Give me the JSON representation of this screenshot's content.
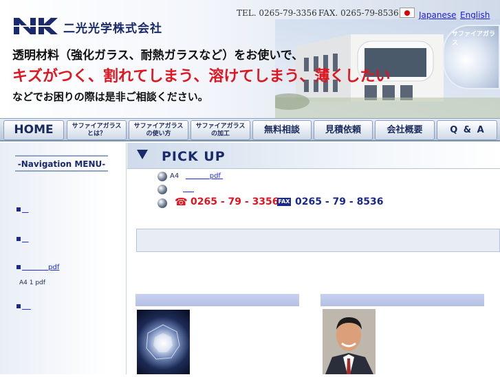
{
  "header": {
    "company_name": "二光光学株式会社",
    "tel": "TEL. 0265-79-3356",
    "fax": "FAX. 0265-79-8536",
    "lang_ja": "Japanese",
    "lang_en": "English",
    "sapphire_label": "サファイアガラス",
    "headline_1": "透明材料（強化ガラス、耐熱ガラスなど）をお使いで、",
    "headline_2": "キズがつく、割れてしまう、溶けてしまう、薄くしたい",
    "headline_3": "などでお困りの際は是非ご相談ください。"
  },
  "nav": {
    "home": "HOME",
    "what_l1": "サファイアガラス",
    "what_l2": "とは？",
    "use_l1": "サファイアガラス",
    "use_l2": "の使い方",
    "proc_l1": "サファイアガラス",
    "proc_l2": "の加工",
    "consult": "無料相談",
    "estimate": "見積依頼",
    "about": "会社概要",
    "qa": "Q & A"
  },
  "sidebar": {
    "title": "-Navigation MENU-",
    "item_4_link": "pdf",
    "note": "A4 1  pdf"
  },
  "main": {
    "pickup_title": "PICK UP",
    "row1_prefix": "A4",
    "row1_link": "pdf",
    "tel_number": "0265 - 79 - 3356",
    "fax_badge": "FAX",
    "fax_number": "0265 - 79 - 8536"
  },
  "colors": {
    "brand_navy": "#1a2a6c",
    "accent_red": "#e0151f",
    "link_blue": "#1a1ae0"
  },
  "icons": {
    "tel": "phone-icon",
    "fax": "fax-icon"
  }
}
